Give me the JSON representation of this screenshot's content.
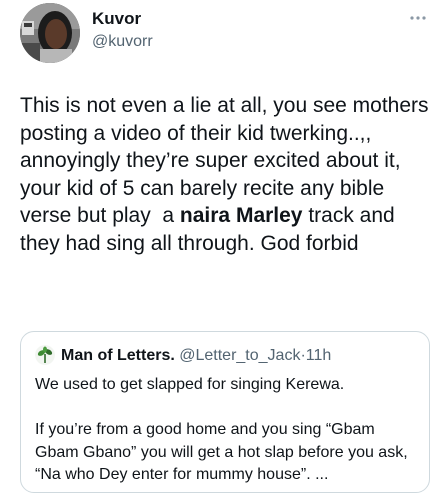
{
  "tweet": {
    "author": {
      "display_name": "Kuvor",
      "handle": "@kuvorr"
    },
    "more_icon": "more-horizontal-icon",
    "text": {
      "part1": "This is not even a lie at all, you see mothers posting a video of their kid twerking..,, annoyingly they’re super excited about it, your kid of 5 can barely recite any bible verse but play  a ",
      "bold": "naira Marley",
      "part2": " track and they had sing all through. God forbid"
    },
    "quoted": {
      "display_name": "Man of Letters.",
      "handle": "@Letter_to_Jack",
      "separator": "·",
      "time": "11h",
      "text": "We used to get slapped for singing Kerewa.\n\nIf you’re from a good home and you sing “Gbam Gbam Gbano” you will get a hot slap before you ask, “Na who Dey enter for mummy house”. ..."
    }
  },
  "colors": {
    "text_primary": "#0f1419",
    "text_secondary": "#536471",
    "border": "#cfd9de"
  }
}
